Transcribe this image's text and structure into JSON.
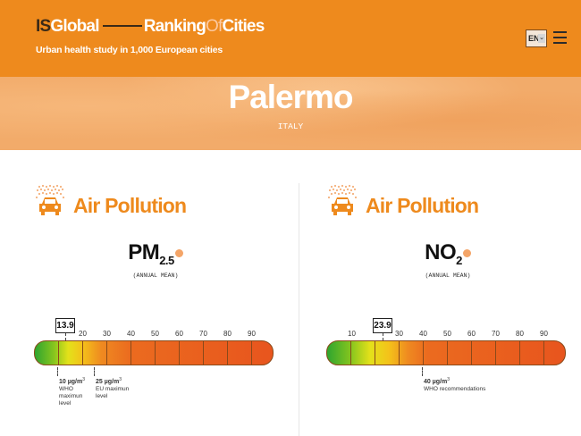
{
  "header": {
    "brand_is": "IS",
    "brand_global": "Global",
    "brand_ranking": "Ranking",
    "brand_of": "Of",
    "brand_cities": "Cities",
    "tagline": "Urban health study in 1,000 European cities",
    "language": "EN",
    "colors": {
      "bar": "#ee8a1d",
      "accent_dark": "#3b2a17"
    }
  },
  "hero": {
    "city": "Palermo",
    "country": "ITALY"
  },
  "panels": [
    {
      "title": "Air Pollution",
      "pollutant_main": "PM",
      "pollutant_sub": "2.5",
      "measure": "(ANNUAL MEAN)",
      "value": 13.9,
      "value_label": "13.9",
      "ticks": [
        "20",
        "30",
        "40",
        "50",
        "60",
        "70",
        "80",
        "90"
      ],
      "notes": [
        {
          "value": "10 µg/m",
          "exp": "3",
          "text": "WHO maximun level"
        },
        {
          "value": "25 µg/m",
          "exp": "3",
          "text": "EU maximun level"
        }
      ]
    },
    {
      "title": "Air Pollution",
      "pollutant_main": "NO",
      "pollutant_sub": "2",
      "measure": "(ANNUAL MEAN)",
      "value": 23.9,
      "value_label": "23.9",
      "ticks": [
        "10",
        "30",
        "40",
        "50",
        "60",
        "70",
        "80",
        "90"
      ],
      "notes": [
        {
          "value": "40 µg/m",
          "exp": "3",
          "text": "WHO recommendations"
        }
      ]
    }
  ]
}
